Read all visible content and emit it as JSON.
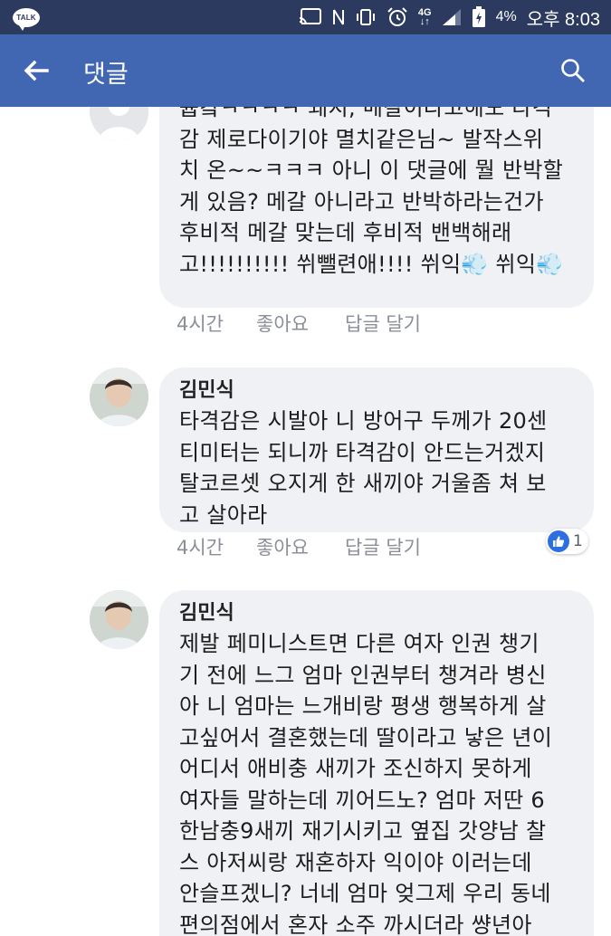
{
  "status_bar": {
    "app_badge": "TALK",
    "network": "4G",
    "battery": "4%",
    "time": "오후 8:03"
  },
  "header": {
    "title": "댓글"
  },
  "icons": {
    "back": "arrow-left-icon",
    "search": "search-icon",
    "reaction": "like-icon"
  },
  "colors": {
    "status_bar_bg": "#2b3a5e",
    "header_bg": "#4267b2",
    "bubble_bg": "#f0f1f4",
    "meta_text": "#8b8f97",
    "like_blue": "#2d6fe0"
  },
  "comments": [
    {
      "author": "",
      "text": "퓹캌ㅋㅋㅋㅋ 돼지, 메갈이라고해도 타격\n감 제로다이기야 멸치같은님~ 발작스위\n치 온~~ㅋㅋㅋ 아니 이 댓글에 뭘 반박할\n게 있음? 메갈 아니라고 반박하라는건가\n후비적 메갈 맞는데 후비적 밴백해래\n고!!!!!!!!!! 쒸뺄련애!!!! 쒸익💨 쒸익💨",
      "time": "4시간",
      "like_label": "좋아요",
      "reply_label": "답글 달기"
    },
    {
      "author": "김민식",
      "text": "타격감은 시발아 니 방어구 두께가 20센\n티미터는 되니까 타격감이 안드는거겠지\n탈코르셋 오지게 한 새끼야 거울좀 쳐 보\n고 살아라",
      "time": "4시간",
      "like_label": "좋아요",
      "reply_label": "답글 달기",
      "reaction_count": "1"
    },
    {
      "author": "김민식",
      "text": "제발 페미니스트면 다른 여자 인권 챙기\n기 전에 느그 엄마 인권부터 챙겨라 병신\n아 니 엄마는 느개비랑 평생 행복하게 살\n고싶어서 결혼했는데 딸이라고 낳은 년이\n어디서 애비충 새끼가 조신하지 못하게\n여자들 말하는데 끼어드노? 엄마 저딴 6\n한남충9새끼 재기시키고 옆집 갓양남 찰\n스 아저씨랑 재혼하자 익이야 이러는데\n안슬프겠니? 너네 엄마 엊그제 우리 동네\n편의점에서 혼자 소주 까시더라 썅년아"
    }
  ]
}
